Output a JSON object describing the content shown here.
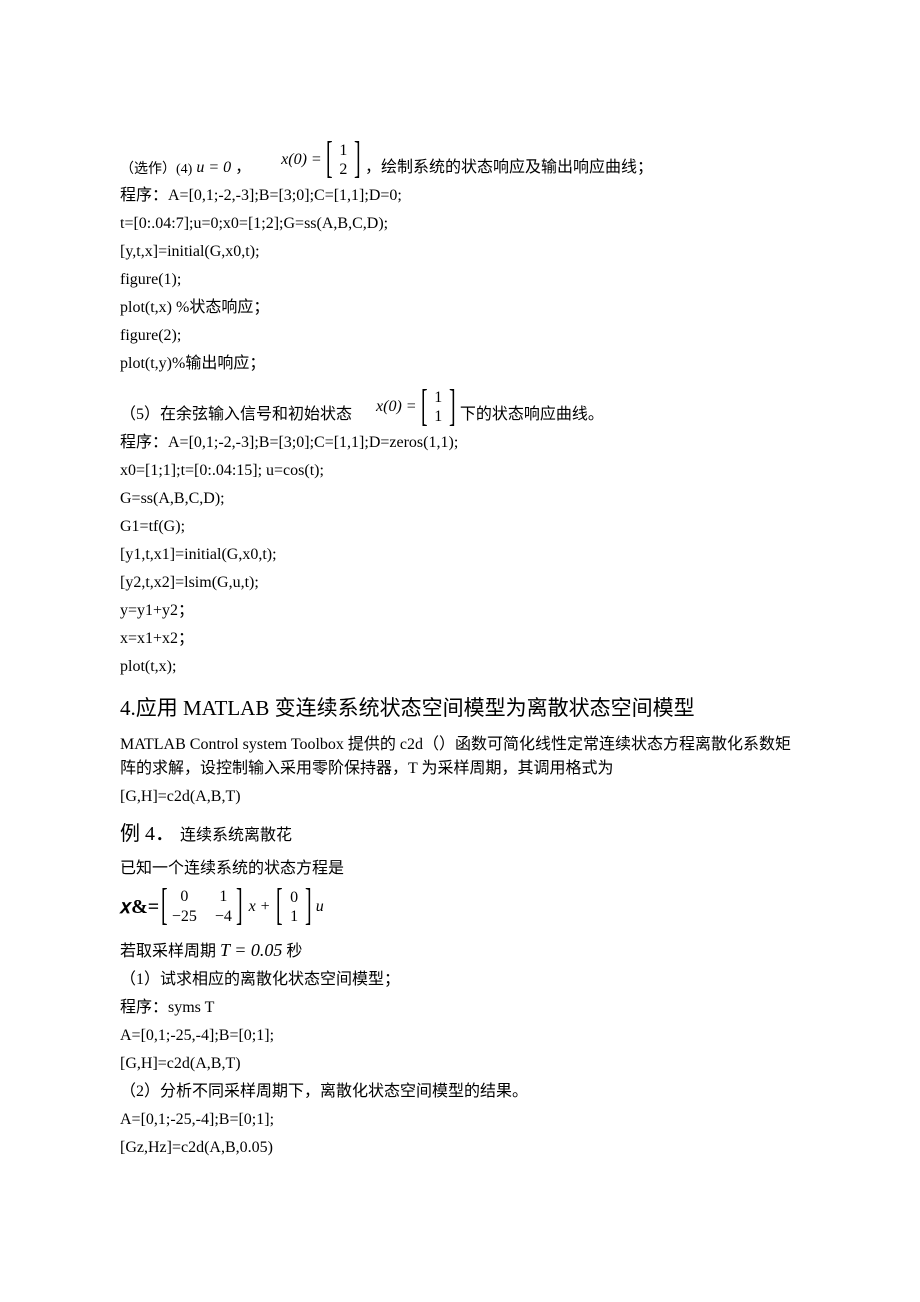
{
  "block4": {
    "intro_prefix": "（选作）(4)",
    "u_eq": "u = 0",
    "x0_lhs": "x(0) =",
    "x0_v": [
      "1",
      "2"
    ],
    "intro_suffix": "，绘制系统的状态响应及输出响应曲线；",
    "code": [
      "程序：A=[0,1;-2,-3];B=[3;0];C=[1,1];D=0;",
      "t=[0:.04:7];u=0;x0=[1;2];G=ss(A,B,C,D);",
      "[y,t,x]=initial(G,x0,t);",
      "figure(1);",
      "plot(t,x)  %状态响应；",
      "figure(2);",
      "plot(t,y)%输出响应；"
    ]
  },
  "block5": {
    "intro_prefix": "（5）在余弦输入信号和初始状态",
    "x0_lhs": "x(0) =",
    "x0_v": [
      "1",
      "1"
    ],
    "intro_suffix": "下的状态响应曲线。",
    "code": [
      "程序：A=[0,1;-2,-3];B=[3;0];C=[1,1];D=zeros(1,1);",
      "x0=[1;1];t=[0:.04:15]; u=cos(t);",
      "G=ss(A,B,C,D);",
      "G1=tf(G);",
      "[y1,t,x1]=initial(G,x0,t);",
      "[y2,t,x2]=lsim(G,u,t);",
      "y=y1+y2；",
      "x=x1+x2；",
      "plot(t,x);"
    ]
  },
  "heading": "4.应用 MATLAB 变连续系统状态空间模型为离散状态空间模型",
  "heading_para": [
    "MATLAB Control system Toolbox 提供的 c2d（）函数可简化线性定常连续状态方程离散化系数矩阵的求解，设控制输入采用零阶保持器，T 为采样周期，其调用格式为",
    "[G,H]=c2d(A,B,T)"
  ],
  "example": {
    "title_left": "例 4．",
    "title_right": "连续系统离散花",
    "known": "已知一个连续系统的状态方程是",
    "eq": {
      "lhs": "x&=",
      "A": [
        "0",
        "1",
        "−25",
        "−4"
      ],
      "mid1": "x +",
      "B": [
        "0",
        "1"
      ],
      "tail": "u"
    },
    "period_pre": "若取采样周期",
    "period_expr": "T = 0.05",
    "period_suf": " 秒",
    "tasks": [
      "（1）试求相应的离散化状态空间模型；",
      "程序：syms T",
      "A=[0,1;-25,-4];B=[0;1];",
      " [G,H]=c2d(A,B,T)",
      "（2）分析不同采样周期下，离散化状态空间模型的结果。",
      "A=[0,1;-25,-4];B=[0;1];",
      " [Gz,Hz]=c2d(A,B,0.05)"
    ]
  }
}
